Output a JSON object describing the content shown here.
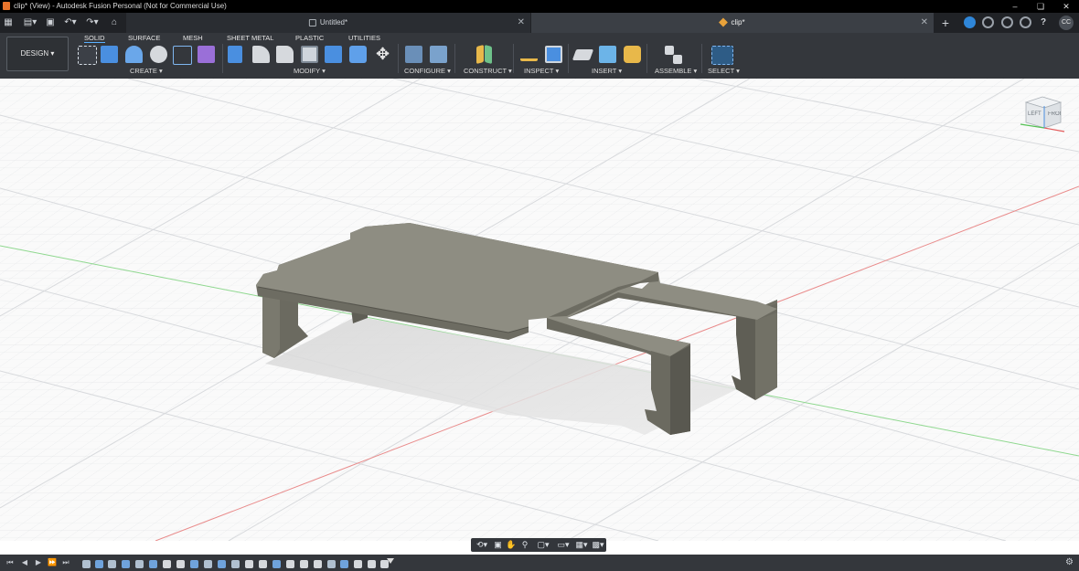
{
  "window": {
    "title": "clip* (View) - Autodesk Fusion Personal (Not for Commercial Use)",
    "controls": [
      "minimize-icon",
      "restore-icon",
      "close-icon"
    ]
  },
  "tabs": [
    {
      "label": "Untitled*",
      "active": false,
      "icon": "lock-icon"
    },
    {
      "label": "clip*",
      "active": true,
      "icon": "cube-icon"
    }
  ],
  "user": {
    "initials": "CC"
  },
  "toolbar": {
    "workspace_button": "DESIGN ▾",
    "workspace_tabs": [
      "SOLID",
      "SURFACE",
      "MESH",
      "SHEET METAL",
      "PLASTIC",
      "UTILITIES"
    ],
    "active_workspace_tab": "SOLID",
    "groups": [
      "CREATE ▾",
      "MODIFY ▾",
      "CONFIGURE ▾",
      "CONSTRUCT ▾",
      "INSPECT ▾",
      "INSERT ▾",
      "ASSEMBLE ▾",
      "SELECT ▾"
    ]
  },
  "viewcube": {
    "left": "LEFT",
    "front": "FRONT"
  },
  "colors": {
    "toolbar_bg": "#34373c",
    "titlebar_bg": "#000000",
    "model_top": "#8e8d82",
    "model_side": "#6b6a60",
    "axis_x": "#e35b5b",
    "axis_y": "#54c154",
    "accent": "#5ab0ff"
  }
}
